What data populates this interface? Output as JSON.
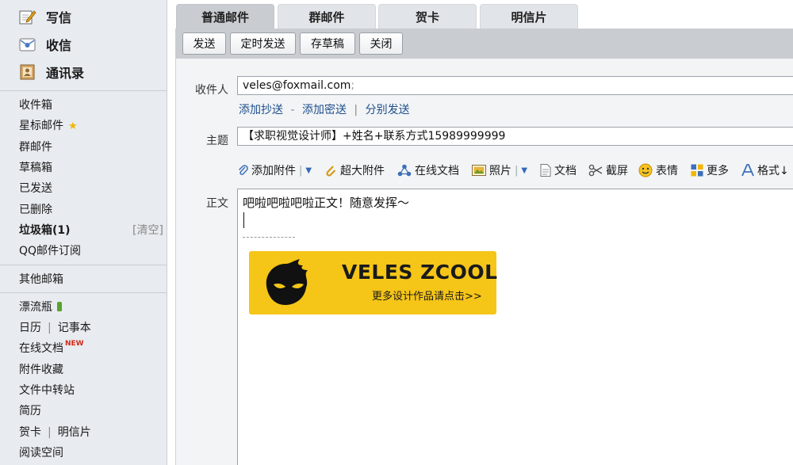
{
  "sidebar": {
    "top": [
      {
        "label": "写信",
        "icon": "pencil-note-icon"
      },
      {
        "label": "收信",
        "icon": "envelope-icon"
      },
      {
        "label": "通讯录",
        "icon": "contacts-book-icon"
      }
    ],
    "folders": {
      "inbox": "收件箱",
      "starred": "星标邮件",
      "group": "群邮件",
      "drafts": "草稿箱",
      "sent": "已发送",
      "deleted": "已删除",
      "spam": "垃圾箱(1)",
      "spam_clear": "[清空]",
      "qq_subscribe": "QQ邮件订阅"
    },
    "other_mailbox": "其他邮箱",
    "apps": {
      "drift_bottle": "漂流瓶",
      "calendar": "日历",
      "notepad": "记事本",
      "online_docs": "在线文档",
      "new_badge": "NEW",
      "attachments": "附件收藏",
      "file_transfer": "文件中转站",
      "resume": "简历",
      "greeting_card": "贺卡",
      "postcard": "明信片",
      "reading_space": "阅读空间",
      "separator": "|"
    }
  },
  "tabs": [
    "普通邮件",
    "群邮件",
    "贺卡",
    "明信片"
  ],
  "toolbar": {
    "send": "发送",
    "scheduled_send": "定时发送",
    "save_draft": "存草稿",
    "close": "关闭"
  },
  "compose": {
    "to_label": "收件人",
    "to_value": "veles@foxmail.com",
    "to_suffix": ";",
    "add_cc": "添加抄送",
    "dash": "-",
    "add_bcc": "添加密送",
    "bar": "|",
    "separate_send": "分别发送",
    "subject_label": "主题",
    "subject_value": "【求职视觉设计师】+姓名+联系方式15989999999",
    "body_label": "正文",
    "body_text": "吧啦吧啦吧啦正文！随意发挥～"
  },
  "editor_toolbar": {
    "add_attachment": "添加附件",
    "big_attachment": "超大附件",
    "online_doc": "在线文档",
    "photo": "照片",
    "document": "文档",
    "screenshot": "截屏",
    "emoji": "表情",
    "more": "更多",
    "format": "格式↓"
  },
  "signature": {
    "title": "VELES ZCOOL",
    "subtitle": "更多设计作品请点击>>"
  },
  "colors": {
    "accent_link": "#1e4f8c",
    "banner_yellow": "#f5c518",
    "new_badge": "#d2291c"
  }
}
